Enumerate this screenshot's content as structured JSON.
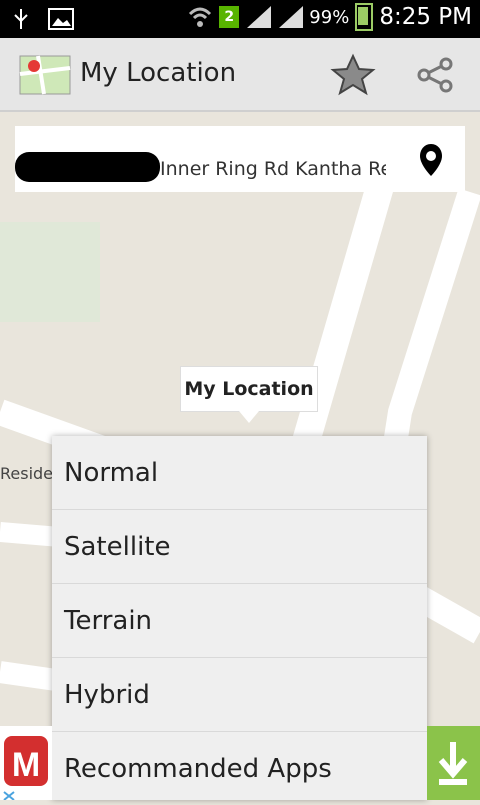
{
  "status_bar": {
    "badge_count": "2",
    "battery": "99%",
    "time": "8:25 PM"
  },
  "app_bar": {
    "title": "My Location"
  },
  "address_card": {
    "text": "Inner Ring Rd Kantha Re"
  },
  "map": {
    "marker_label": "My Location",
    "place_label_partial": "Resider"
  },
  "menu": {
    "items": [
      {
        "label": "Normal"
      },
      {
        "label": "Satellite"
      },
      {
        "label": "Terrain"
      },
      {
        "label": "Hybrid"
      },
      {
        "label": "Recommanded Apps"
      }
    ]
  },
  "icons": {
    "usb": "usb-icon",
    "gallery": "image-icon",
    "wifi": "wifi-icon",
    "signal": "signal-icon",
    "battery": "battery-charging-icon",
    "star": "star-icon",
    "share": "share-icon",
    "pin": "map-pin-icon",
    "download": "download-icon"
  },
  "colors": {
    "ad_green": "#8bc34a",
    "badge_green": "#58b400"
  }
}
